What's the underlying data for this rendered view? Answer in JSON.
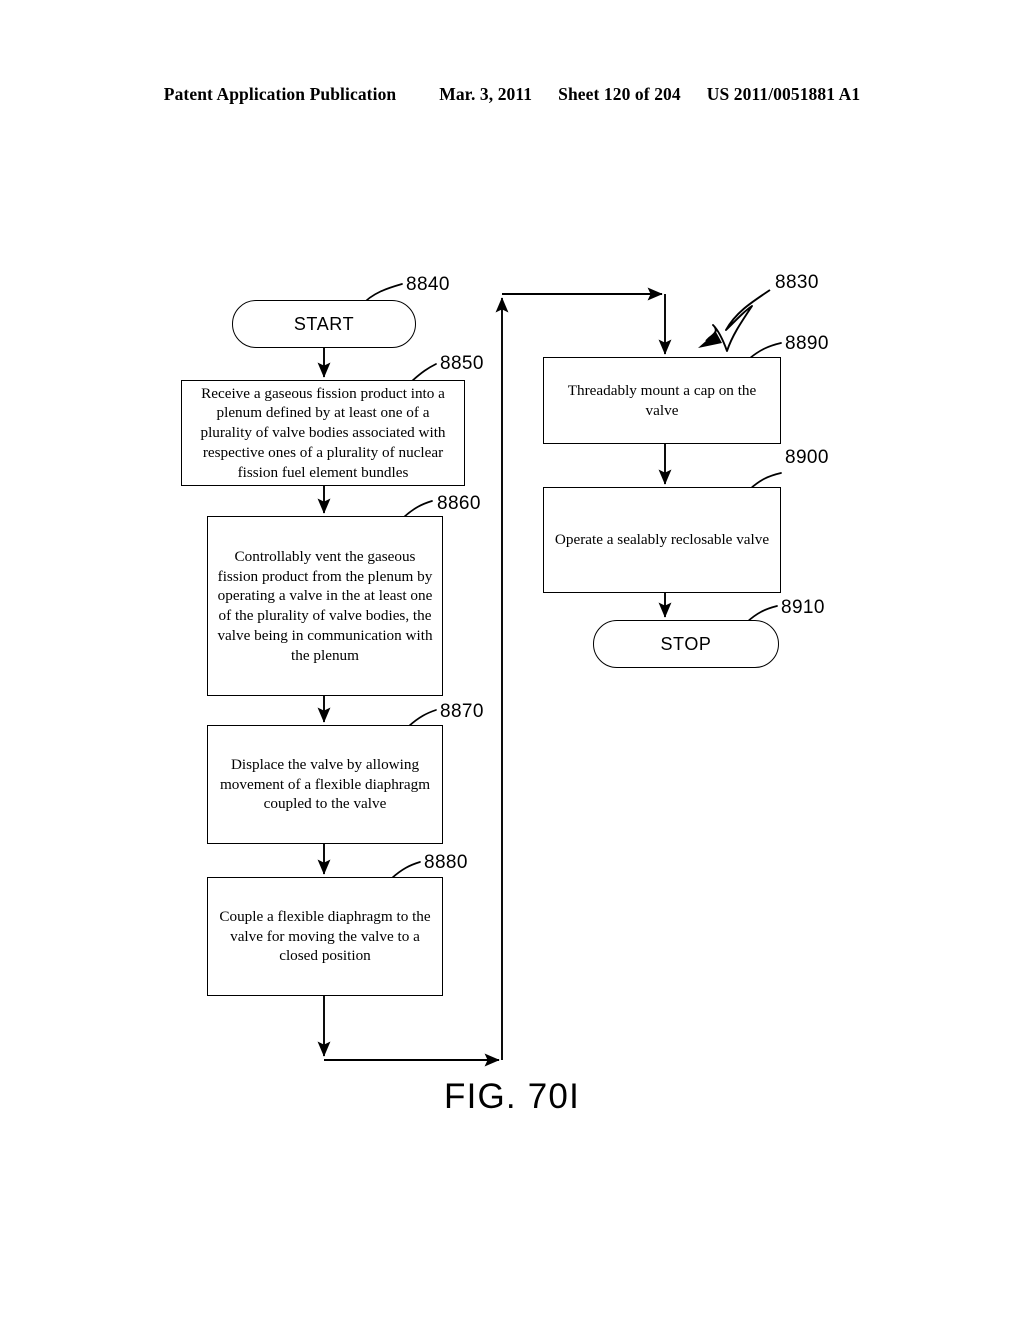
{
  "header": {
    "publication": "Patent Application Publication",
    "date": "Mar. 3, 2011",
    "sheet": "Sheet 120 of 204",
    "doc_number": "US 2011/0051881 A1"
  },
  "figure": {
    "caption": "FIG. 70I",
    "overall_ref": "8830"
  },
  "nodes": {
    "start": {
      "ref": "8840",
      "label": "START"
    },
    "step_8850": {
      "ref": "8850",
      "label": "Receive a gaseous fission product into a plenum defined by at least one of a plurality of valve bodies associated with respective ones of a plurality of nuclear fission fuel element bundles"
    },
    "step_8860": {
      "ref": "8860",
      "label": "Controllably vent the gaseous fission product from the plenum by operating a valve in the at least one of the plurality of valve bodies, the valve being in communication with the plenum"
    },
    "step_8870": {
      "ref": "8870",
      "label": "Displace the valve by allowing movement of a flexible diaphragm coupled to the valve"
    },
    "step_8880": {
      "ref": "8880",
      "label": "Couple a flexible diaphragm to the valve for moving the valve to a closed position"
    },
    "step_8890": {
      "ref": "8890",
      "label": "Threadably mount a cap on the valve"
    },
    "step_8900": {
      "ref": "8900",
      "label": "Operate a sealably reclosable valve"
    },
    "stop": {
      "ref": "8910",
      "label": "STOP"
    }
  },
  "style": {
    "ink": "#000000",
    "paper": "#ffffff"
  }
}
